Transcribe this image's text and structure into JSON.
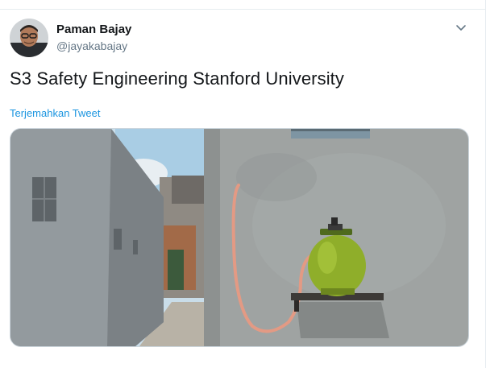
{
  "tweet": {
    "author_name": "Paman Bajay",
    "author_handle": "@jayakabajay",
    "text": "S3 Safety Engineering Stanford University",
    "translate_label": "Terjemahkan Tweet"
  },
  "icons": {
    "menu": "chevron-down-icon",
    "avatar": "avatar"
  },
  "colors": {
    "link": "#1b95e0",
    "handle": "#657786",
    "text": "#14171a",
    "divider": "#e6ecf0"
  }
}
